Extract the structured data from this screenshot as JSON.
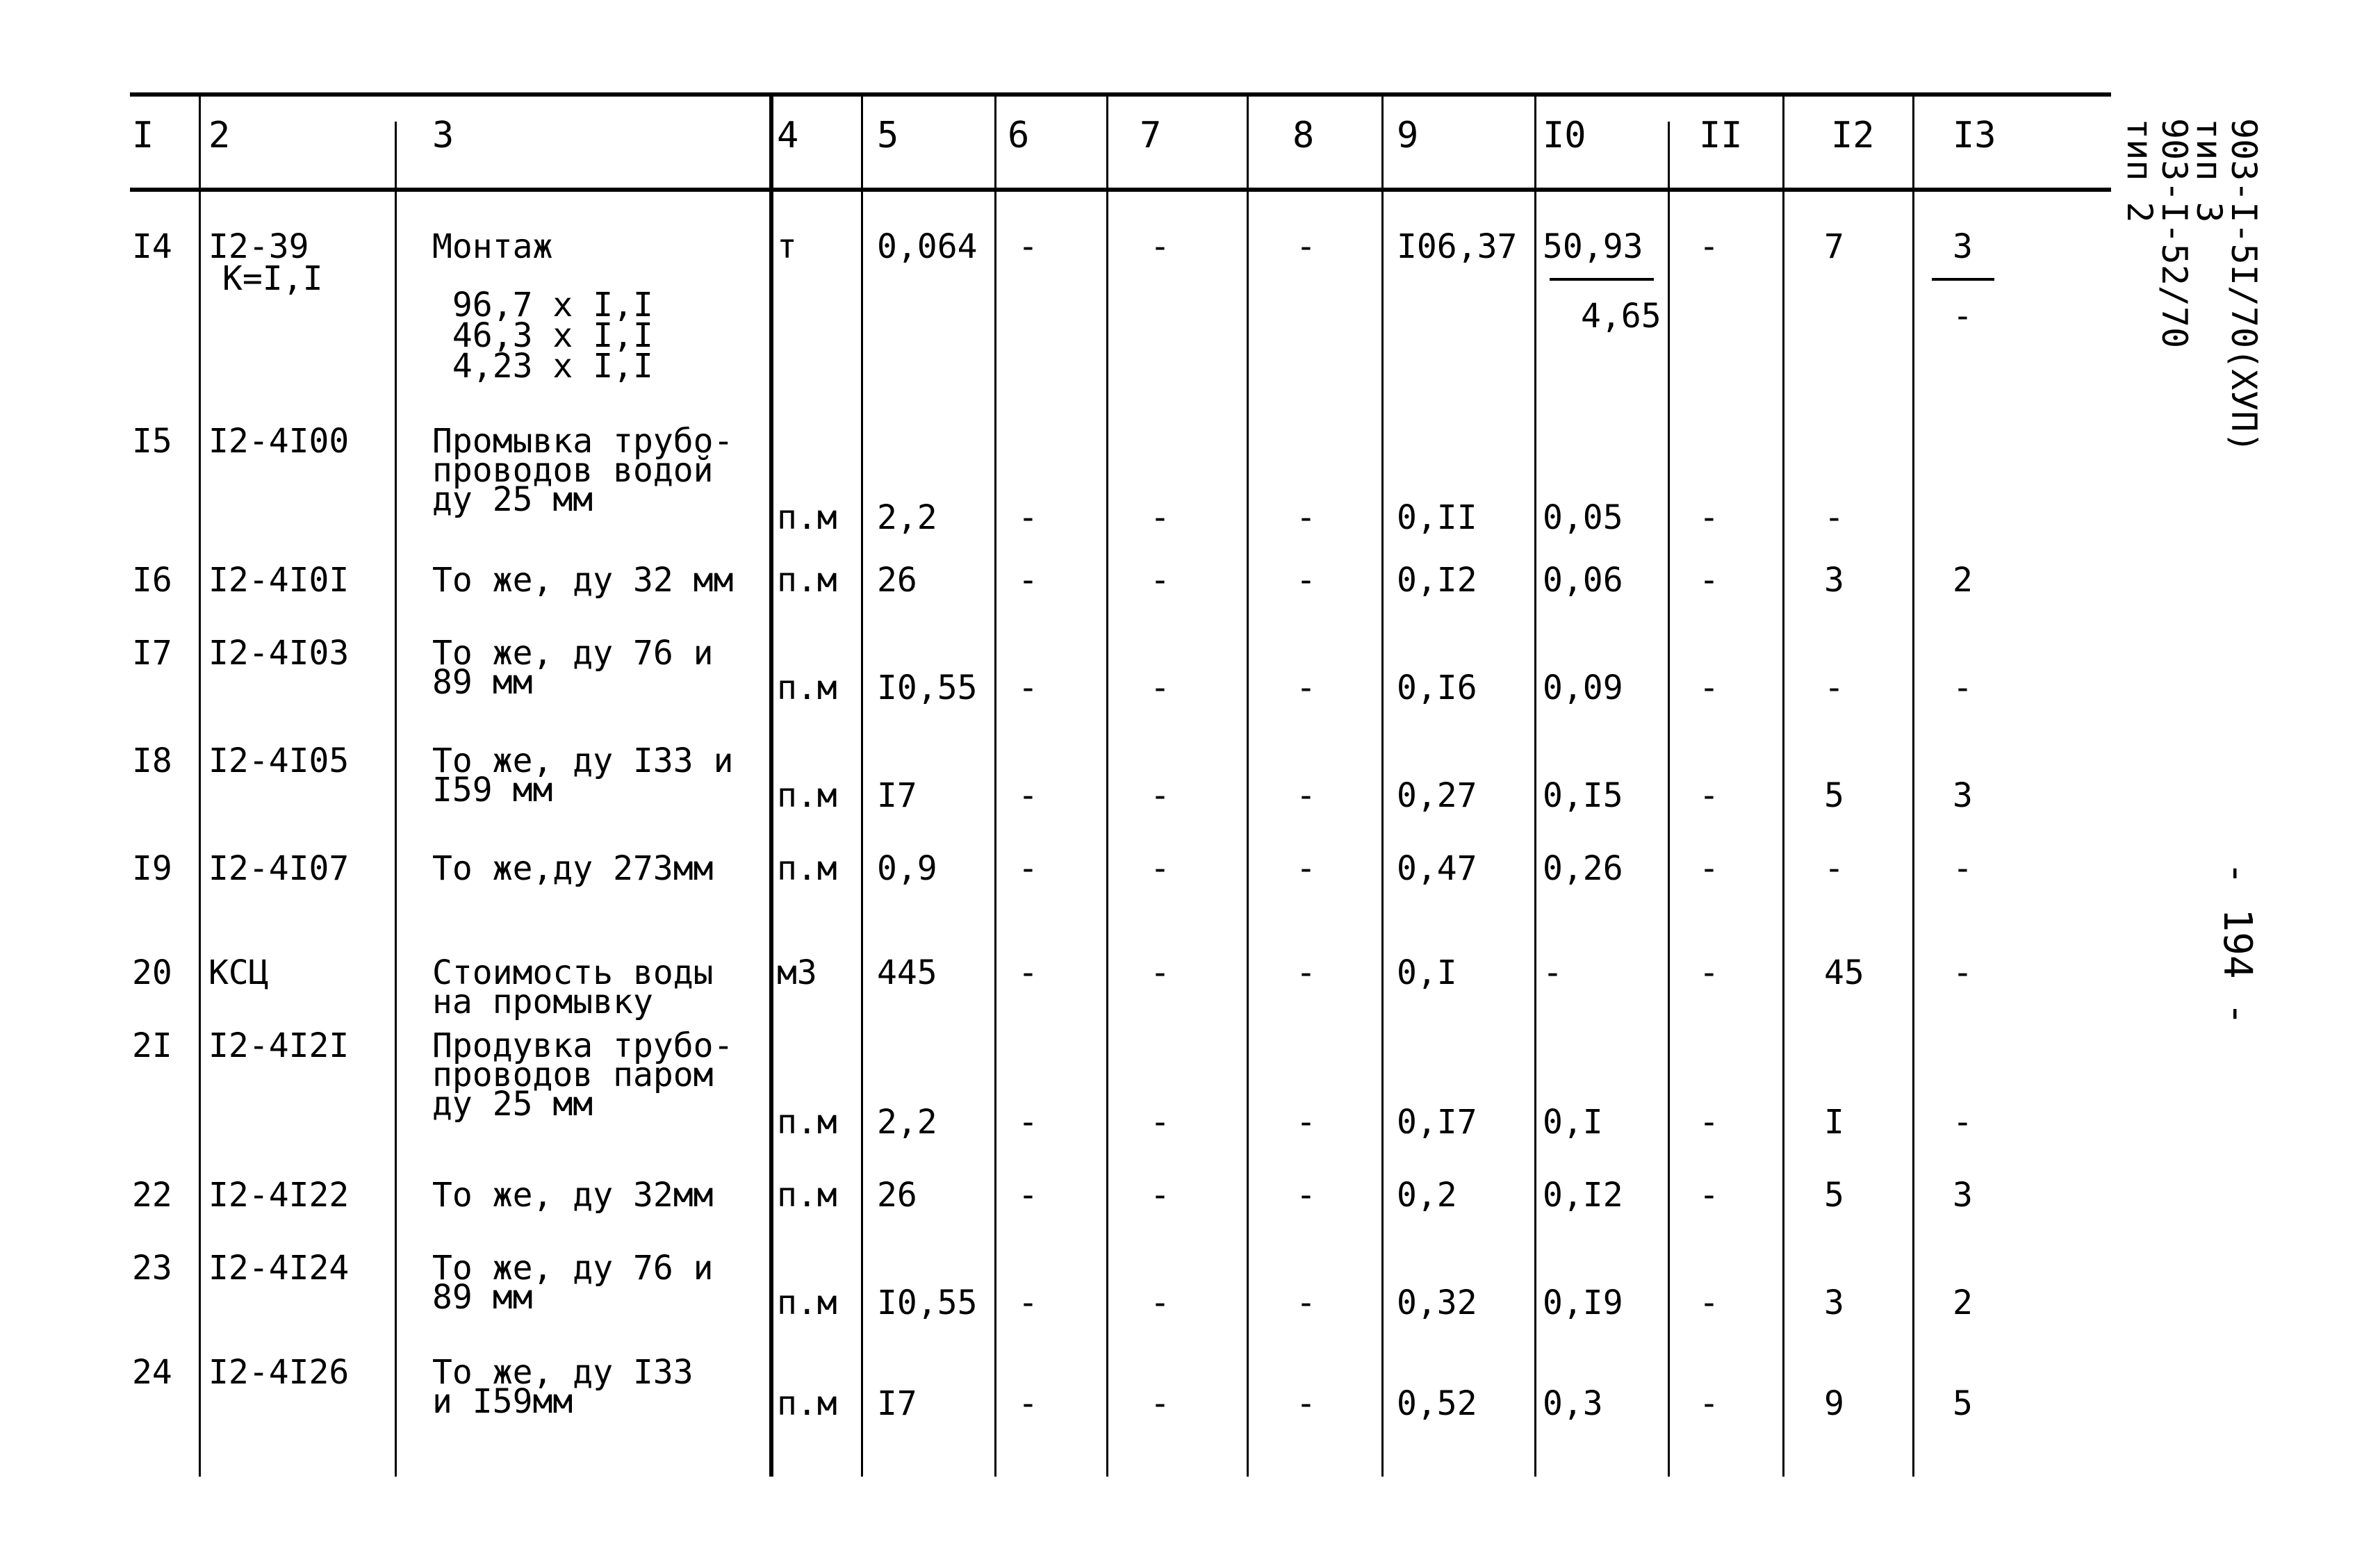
{
  "side_header": {
    "line1": "903-I-5I/70(XУП)",
    "line2": "тип 3",
    "line3": "903-I-52/70",
    "line4": "тип 2"
  },
  "page_number": "- 194 -",
  "table": {
    "columns": [
      "I",
      "2",
      "3",
      "4",
      "5",
      "6",
      "7",
      "8",
      "9",
      "I0",
      "II",
      "I2",
      "I3"
    ],
    "rows": [
      {
        "c1": "I4",
        "c2": [
          "I2-39",
          "K=I,I"
        ],
        "c3": [
          "Монтаж",
          " 96,7 x I,I",
          " 46,3 x I,I",
          " 4,23 x I,I"
        ],
        "c4": "т",
        "c5": "0,064",
        "c6": "-",
        "c7": "-",
        "c8": "-",
        "c9": "I06,37",
        "c10": "50,93",
        "c10b": "4,65",
        "c11": "-",
        "c12": "7",
        "c13": "3",
        "c13b": "-"
      },
      {
        "c1": "I5",
        "c2": [
          "I2-4I00"
        ],
        "c3": [
          "Промывка трубо-",
          "проводов водой",
          "ду 25 мм"
        ],
        "c4": "п.м",
        "c5": "2,2",
        "c6": "-",
        "c7": "-",
        "c8": "-",
        "c9": "0,II",
        "c10": "0,05",
        "c11": "-",
        "c12": "-",
        "c13": ""
      },
      {
        "c1": "I6",
        "c2": [
          "I2-4I0I"
        ],
        "c3": [
          "То же, ду 32 мм"
        ],
        "c4": "п.м",
        "c5": "26",
        "c6": "-",
        "c7": "-",
        "c8": "-",
        "c9": "0,I2",
        "c10": "0,06",
        "c11": "-",
        "c12": "3",
        "c13": "2"
      },
      {
        "c1": "I7",
        "c2": [
          "I2-4I03"
        ],
        "c3": [
          "То же, ду 76 и",
          "89 мм"
        ],
        "c4": "п.м",
        "c5": "I0,55",
        "c6": "-",
        "c7": "-",
        "c8": "-",
        "c9": "0,I6",
        "c10": "0,09",
        "c11": "-",
        "c12": "-",
        "c13": "-"
      },
      {
        "c1": "I8",
        "c2": [
          "I2-4I05"
        ],
        "c3": [
          "То же, ду I33 и",
          "I59 мм"
        ],
        "c4": "п.м",
        "c5": "I7",
        "c6": "-",
        "c7": "-",
        "c8": "-",
        "c9": "0,27",
        "c10": "0,I5",
        "c11": "-",
        "c12": "5",
        "c13": "3"
      },
      {
        "c1": "I9",
        "c2": [
          "I2-4I07"
        ],
        "c3": [
          "То же,ду 273мм"
        ],
        "c4": "п.м",
        "c5": "0,9",
        "c6": "-",
        "c7": "-",
        "c8": "-",
        "c9": "0,47",
        "c10": "0,26",
        "c11": "-",
        "c12": "-",
        "c13": "-"
      },
      {
        "c1": "20",
        "c2": [
          "КСЦ"
        ],
        "c3": [
          "Стоимость воды",
          "на промывку"
        ],
        "c4": "м3",
        "c5": "445",
        "c6": "-",
        "c7": "-",
        "c8": "-",
        "c9": "0,I",
        "c10": "-",
        "c11": "-",
        "c12": "45",
        "c13": "-"
      },
      {
        "c1": "2I",
        "c2": [
          "I2-4I2I"
        ],
        "c3": [
          "Продувка трубо-",
          "проводов паром",
          "ду 25 мм"
        ],
        "c4": "п.м",
        "c5": "2,2",
        "c6": "-",
        "c7": "-",
        "c8": "-",
        "c9": "0,I7",
        "c10": "0,I",
        "c11": "-",
        "c12": "I",
        "c13": "-"
      },
      {
        "c1": "22",
        "c2": [
          "I2-4I22"
        ],
        "c3": [
          "То же, ду 32мм"
        ],
        "c4": "п.м",
        "c5": "26",
        "c6": "-",
        "c7": "-",
        "c8": "-",
        "c9": "0,2",
        "c10": "0,I2",
        "c11": "-",
        "c12": "5",
        "c13": "3"
      },
      {
        "c1": "23",
        "c2": [
          "I2-4I24"
        ],
        "c3": [
          "То же, ду 76 и",
          "89 мм"
        ],
        "c4": "п.м",
        "c5": "I0,55",
        "c6": "-",
        "c7": "-",
        "c8": "-",
        "c9": "0,32",
        "c10": "0,I9",
        "c11": "-",
        "c12": "3",
        "c13": "2"
      },
      {
        "c1": "24",
        "c2": [
          "I2-4I26"
        ],
        "c3": [
          "То же, ду I33",
          "и I59мм"
        ],
        "c4": "п.м",
        "c5": "I7",
        "c6": "-",
        "c7": "-",
        "c8": "-",
        "c9": "0,52",
        "c10": "0,3",
        "c11": "-",
        "c12": "9",
        "c13": "5"
      }
    ]
  }
}
